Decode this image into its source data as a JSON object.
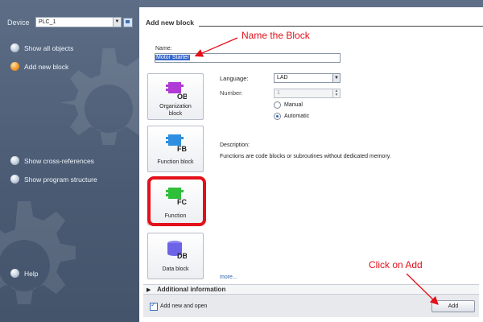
{
  "sidebar": {
    "device_label": "Device",
    "device_value": "PLC_1",
    "items": [
      {
        "label": "Show all objects",
        "active": false
      },
      {
        "label": "Add new block",
        "active": true
      },
      {
        "label": "Show cross-references",
        "active": false
      },
      {
        "label": "Show program structure",
        "active": false
      },
      {
        "label": "Help",
        "active": false
      }
    ]
  },
  "panel": {
    "title": "Add new block",
    "name_label": "Name:",
    "name_value": "Motor Starter",
    "blocks": [
      {
        "code": "OB",
        "label_line1": "Organization",
        "label_line2": "block"
      },
      {
        "code": "FB",
        "label_line1": "Function block",
        "label_line2": ""
      },
      {
        "code": "FC",
        "label_line1": "Function",
        "label_line2": ""
      },
      {
        "code": "DB",
        "label_line1": "Data block",
        "label_line2": ""
      }
    ],
    "language_label": "Language:",
    "language_value": "LAD",
    "number_label": "Number:",
    "number_value": "1",
    "radio_manual": "Manual",
    "radio_automatic": "Automatic",
    "description_label": "Description:",
    "description_text": "Functions are code blocks or subroutines without dedicated memory.",
    "more_link": "more...",
    "additional_info": "Additional information",
    "add_new_open": "Add new and open",
    "add_button": "Add"
  },
  "annotations": {
    "name_block": "Name the Block",
    "click_add": "Click on Add"
  },
  "colors": {
    "sidebar_bg": "#4f5f77",
    "highlight": "#e3101a",
    "ob_icon": "#b03ad6",
    "fb_icon": "#2f8ee0",
    "fc_icon": "#2fbf3a",
    "db_icon": "#6d63e8"
  }
}
